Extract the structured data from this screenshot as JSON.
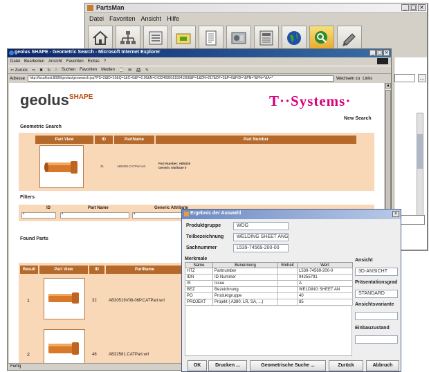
{
  "partsman": {
    "title": "PartsMan",
    "menu": [
      "Datei",
      "Favoriten",
      "Ansicht",
      "Hilfe"
    ],
    "toolbar_icons": [
      "home-icon",
      "tree-structure-icon",
      "list-icon",
      "folder-icon",
      "document-icon",
      "parts-icon",
      "form-icon",
      "globe-icon",
      "search-icon",
      "pencil-icon"
    ]
  },
  "ie": {
    "title": "geolus SHAPE - Geometric Search - Microsoft Internet Explorer",
    "menu": [
      "Datei",
      "Bearbeiten",
      "Ansicht",
      "Favoriten",
      "Extras",
      "?"
    ],
    "toolbar": [
      "⇦ Zurück",
      "⇨",
      "✖",
      "↻",
      "⌂",
      "Suchen",
      "Favoriten",
      "Medien",
      "⌚",
      "✉",
      "🖨",
      "✎"
    ],
    "address_label": "Adresse",
    "address": "http://localhost:8080/geolus/geosearch.jsp?PS=2&ID=10&Q=1&C=0&P=0.06&N=0.03246891615941956&P=1&DN=217&DF=2&P=0&FID=*&PN=*&FN=*&A=*",
    "go_label": "Wechseln zu",
    "links_label": "Links",
    "status": "Fertig"
  },
  "page": {
    "logo_main": "geolus",
    "logo_sup": "SHAPE",
    "tsystems": "T··Systems·",
    "geometric_search": "Geometric Search",
    "new_search": "New Search",
    "query_headers": [
      "Part View",
      "ID",
      "PartName",
      "Part Number"
    ],
    "query_id": "31",
    "query_partname": "AB5326.CATPart.wrl",
    "query_partnumber_line1": "Part Number: AB5326",
    "query_partnumber_line2": "Generic Attribute 0",
    "filters": "Filters",
    "filter_labels": [
      "ID",
      "Part Name",
      "Generic Attribute"
    ],
    "filter_values": [
      "*",
      "*",
      "*"
    ],
    "found_parts": "Found Parts",
    "results_headers": [
      "Result",
      "Part View",
      "ID",
      "PartName"
    ],
    "results": [
      {
        "result": "1",
        "id": "32",
        "name": "AB30519V06-06P.CATPart.wrl"
      },
      {
        "result": "2",
        "id": "48",
        "name": "AB32581.CATPart.wrl"
      }
    ]
  },
  "dialog": {
    "title": "Ergebnis der Auswahl",
    "produktgruppe_label": "Produktgruppe",
    "produktgruppe": "WDG",
    "teilbezeichnung_label": "Teilbezeichnung",
    "teilbezeichnung": "WELDING SHEET ANG",
    "sachnummer_label": "Sachnummer",
    "sachnummer": "L539-74569-200-00",
    "merkmale_label": "Merkmale",
    "columns": [
      "Name",
      "Benennung",
      "Einheit",
      "Wert"
    ],
    "rows": [
      [
        "HTZ",
        "Partnumber",
        "",
        "L539-74569-200-0"
      ],
      [
        "IDN",
        "ID-Nummer",
        "",
        "94255791"
      ],
      [
        "IS",
        "Issue",
        "",
        "A"
      ],
      [
        "BEZ",
        "Bezeichnung",
        "",
        "WELDING SHEET AN"
      ],
      [
        "PO",
        "Produktgruppe",
        "",
        "40"
      ],
      [
        "PROJEKT",
        "Projekt ( A380, LR, SA, ...)",
        "",
        "85"
      ]
    ],
    "ansicht_label": "Ansicht",
    "ansicht": "3D-ANSICHT",
    "praesentationsgrad_label": "Präsentationsgrad",
    "praesentationsgrad": "STANDARD",
    "ansichtsvariante_label": "Ansichtsvariante",
    "ansichtsvariante": "",
    "einbauzustand_label": "Einbauzustand",
    "einbauzustand": "",
    "buttons": {
      "ok": "OK",
      "drucken": "Drucken ...",
      "geometrische_suche": "Geometrische Suche ...",
      "zurueck": "Zurück",
      "abbruch": "Abbruch"
    }
  }
}
